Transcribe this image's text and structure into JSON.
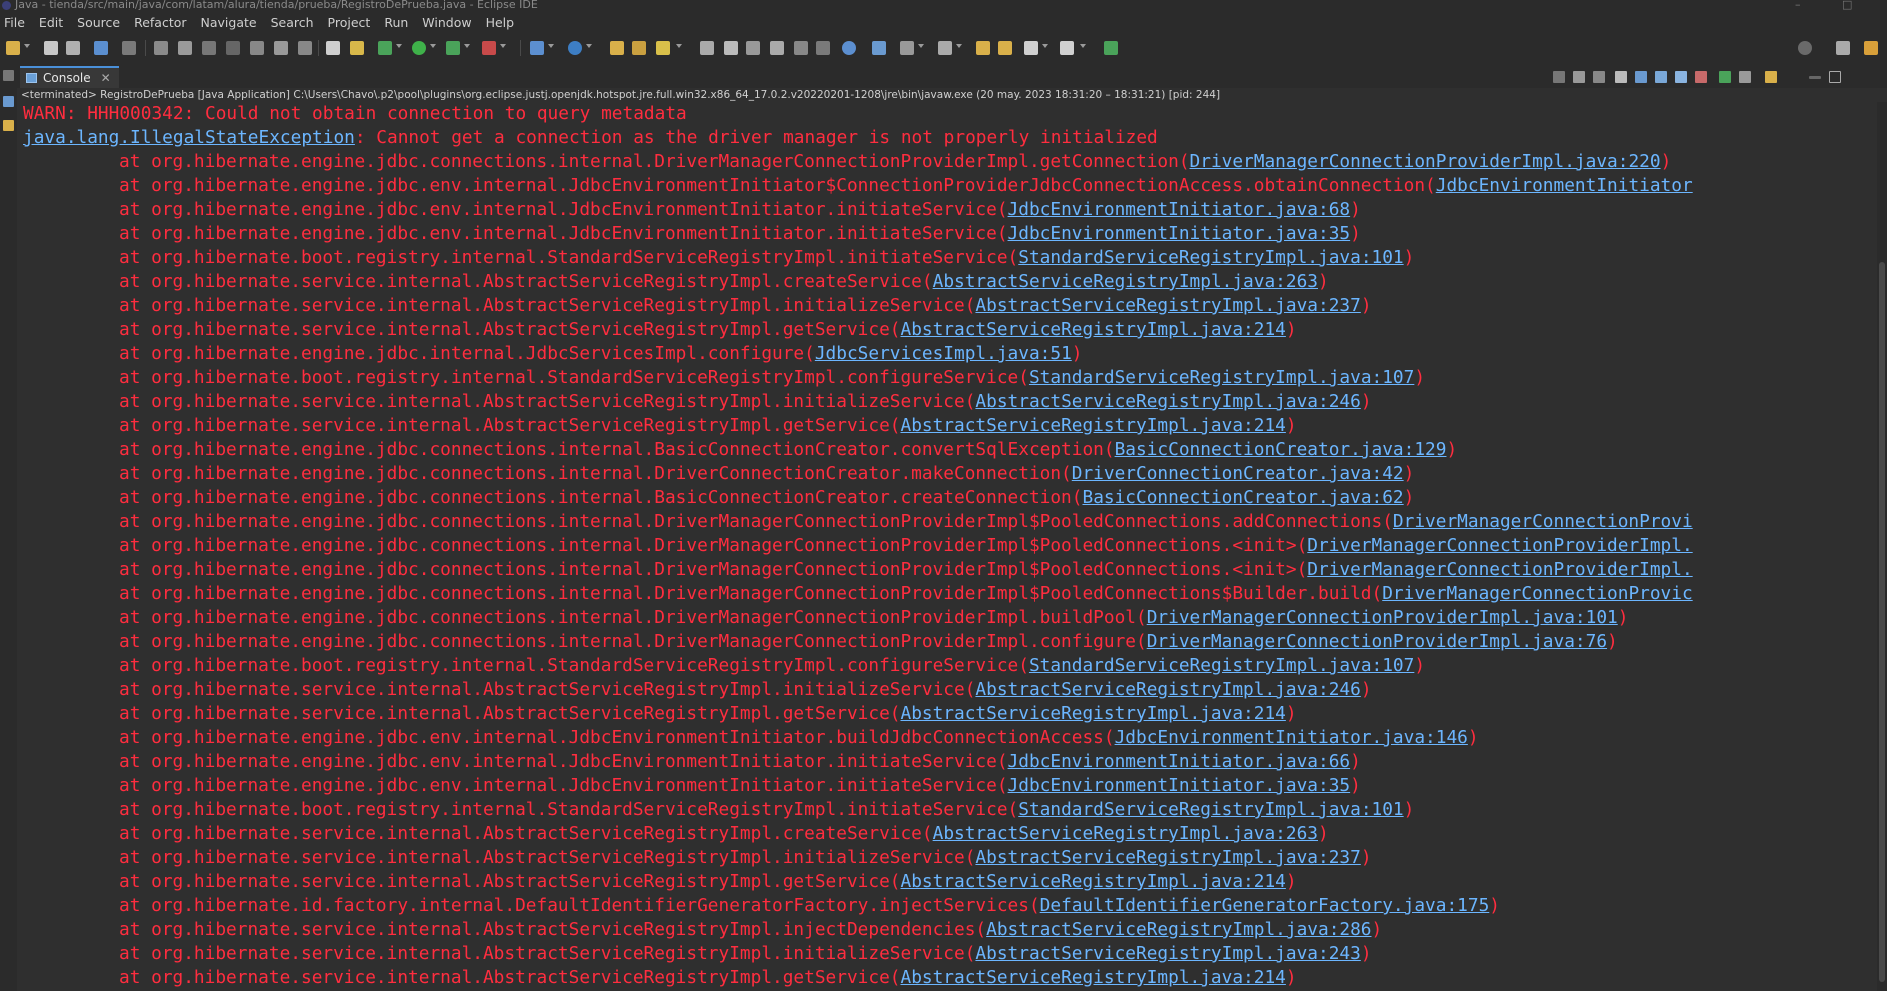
{
  "window": {
    "title": "Java - tienda/src/main/java/com/latam/alura/tienda/prueba/RegistroDePrueba.java - Eclipse IDE"
  },
  "menu": [
    "File",
    "Edit",
    "Source",
    "Refactor",
    "Navigate",
    "Search",
    "Project",
    "Run",
    "Window",
    "Help"
  ],
  "console_tab": {
    "label": "Console"
  },
  "status": "<terminated> RegistroDePrueba [Java Application] C:\\Users\\Chavo\\.p2\\pool\\plugins\\org.eclipse.justj.openjdk.hotspot.jre.full.win32.x86_64_17.0.2.v20220201-1208\\jre\\bin\\javaw.exe  (20 may. 2023 18:31:20 – 18:31:21) [pid: 244]",
  "console": {
    "warn": "WARN: HHH000342: Could not obtain connection to query metadata",
    "exception": {
      "class": "java.lang.IllegalStateException",
      "message": ": Cannot get a connection as the driver manager is not properly initialized"
    },
    "frames": [
      {
        "method": "at org.hibernate.engine.jdbc.connections.internal.DriverManagerConnectionProviderImpl.getConnection(",
        "link": "DriverManagerConnectionProviderImpl.java:220",
        "tail": ")"
      },
      {
        "method": "at org.hibernate.engine.jdbc.env.internal.JdbcEnvironmentInitiator$ConnectionProviderJdbcConnectionAccess.obtainConnection(",
        "link": "JdbcEnvironmentInitiator",
        "tail": ""
      },
      {
        "method": "at org.hibernate.engine.jdbc.env.internal.JdbcEnvironmentInitiator.initiateService(",
        "link": "JdbcEnvironmentInitiator.java:68",
        "tail": ")"
      },
      {
        "method": "at org.hibernate.engine.jdbc.env.internal.JdbcEnvironmentInitiator.initiateService(",
        "link": "JdbcEnvironmentInitiator.java:35",
        "tail": ")"
      },
      {
        "method": "at org.hibernate.boot.registry.internal.StandardServiceRegistryImpl.initiateService(",
        "link": "StandardServiceRegistryImpl.java:101",
        "tail": ")"
      },
      {
        "method": "at org.hibernate.service.internal.AbstractServiceRegistryImpl.createService(",
        "link": "AbstractServiceRegistryImpl.java:263",
        "tail": ")"
      },
      {
        "method": "at org.hibernate.service.internal.AbstractServiceRegistryImpl.initializeService(",
        "link": "AbstractServiceRegistryImpl.java:237",
        "tail": ")"
      },
      {
        "method": "at org.hibernate.service.internal.AbstractServiceRegistryImpl.getService(",
        "link": "AbstractServiceRegistryImpl.java:214",
        "tail": ")"
      },
      {
        "method": "at org.hibernate.engine.jdbc.internal.JdbcServicesImpl.configure(",
        "link": "JdbcServicesImpl.java:51",
        "tail": ")"
      },
      {
        "method": "at org.hibernate.boot.registry.internal.StandardServiceRegistryImpl.configureService(",
        "link": "StandardServiceRegistryImpl.java:107",
        "tail": ")"
      },
      {
        "method": "at org.hibernate.service.internal.AbstractServiceRegistryImpl.initializeService(",
        "link": "AbstractServiceRegistryImpl.java:246",
        "tail": ")"
      },
      {
        "method": "at org.hibernate.service.internal.AbstractServiceRegistryImpl.getService(",
        "link": "AbstractServiceRegistryImpl.java:214",
        "tail": ")"
      },
      {
        "method": "at org.hibernate.engine.jdbc.connections.internal.BasicConnectionCreator.convertSqlException(",
        "link": "BasicConnectionCreator.java:129",
        "tail": ")"
      },
      {
        "method": "at org.hibernate.engine.jdbc.connections.internal.DriverConnectionCreator.makeConnection(",
        "link": "DriverConnectionCreator.java:42",
        "tail": ")"
      },
      {
        "method": "at org.hibernate.engine.jdbc.connections.internal.BasicConnectionCreator.createConnection(",
        "link": "BasicConnectionCreator.java:62",
        "tail": ")"
      },
      {
        "method": "at org.hibernate.engine.jdbc.connections.internal.DriverManagerConnectionProviderImpl$PooledConnections.addConnections(",
        "link": "DriverManagerConnectionProvi",
        "tail": ""
      },
      {
        "method": "at org.hibernate.engine.jdbc.connections.internal.DriverManagerConnectionProviderImpl$PooledConnections.<init>(",
        "link": "DriverManagerConnectionProviderImpl.",
        "tail": ""
      },
      {
        "method": "at org.hibernate.engine.jdbc.connections.internal.DriverManagerConnectionProviderImpl$PooledConnections.<init>(",
        "link": "DriverManagerConnectionProviderImpl.",
        "tail": ""
      },
      {
        "method": "at org.hibernate.engine.jdbc.connections.internal.DriverManagerConnectionProviderImpl$PooledConnections$Builder.build(",
        "link": "DriverManagerConnectionProvic",
        "tail": ""
      },
      {
        "method": "at org.hibernate.engine.jdbc.connections.internal.DriverManagerConnectionProviderImpl.buildPool(",
        "link": "DriverManagerConnectionProviderImpl.java:101",
        "tail": ")"
      },
      {
        "method": "at org.hibernate.engine.jdbc.connections.internal.DriverManagerConnectionProviderImpl.configure(",
        "link": "DriverManagerConnectionProviderImpl.java:76",
        "tail": ")"
      },
      {
        "method": "at org.hibernate.boot.registry.internal.StandardServiceRegistryImpl.configureService(",
        "link": "StandardServiceRegistryImpl.java:107",
        "tail": ")"
      },
      {
        "method": "at org.hibernate.service.internal.AbstractServiceRegistryImpl.initializeService(",
        "link": "AbstractServiceRegistryImpl.java:246",
        "tail": ")"
      },
      {
        "method": "at org.hibernate.service.internal.AbstractServiceRegistryImpl.getService(",
        "link": "AbstractServiceRegistryImpl.java:214",
        "tail": ")"
      },
      {
        "method": "at org.hibernate.engine.jdbc.env.internal.JdbcEnvironmentInitiator.buildJdbcConnectionAccess(",
        "link": "JdbcEnvironmentInitiator.java:146",
        "tail": ")"
      },
      {
        "method": "at org.hibernate.engine.jdbc.env.internal.JdbcEnvironmentInitiator.initiateService(",
        "link": "JdbcEnvironmentInitiator.java:66",
        "tail": ")"
      },
      {
        "method": "at org.hibernate.engine.jdbc.env.internal.JdbcEnvironmentInitiator.initiateService(",
        "link": "JdbcEnvironmentInitiator.java:35",
        "tail": ")"
      },
      {
        "method": "at org.hibernate.boot.registry.internal.StandardServiceRegistryImpl.initiateService(",
        "link": "StandardServiceRegistryImpl.java:101",
        "tail": ")"
      },
      {
        "method": "at org.hibernate.service.internal.AbstractServiceRegistryImpl.createService(",
        "link": "AbstractServiceRegistryImpl.java:263",
        "tail": ")"
      },
      {
        "method": "at org.hibernate.service.internal.AbstractServiceRegistryImpl.initializeService(",
        "link": "AbstractServiceRegistryImpl.java:237",
        "tail": ")"
      },
      {
        "method": "at org.hibernate.service.internal.AbstractServiceRegistryImpl.getService(",
        "link": "AbstractServiceRegistryImpl.java:214",
        "tail": ")"
      },
      {
        "method": "at org.hibernate.id.factory.internal.DefaultIdentifierGeneratorFactory.injectServices(",
        "link": "DefaultIdentifierGeneratorFactory.java:175",
        "tail": ")"
      },
      {
        "method": "at org.hibernate.service.internal.AbstractServiceRegistryImpl.injectDependencies(",
        "link": "AbstractServiceRegistryImpl.java:286",
        "tail": ")"
      },
      {
        "method": "at org.hibernate.service.internal.AbstractServiceRegistryImpl.initializeService(",
        "link": "AbstractServiceRegistryImpl.java:243",
        "tail": ")"
      },
      {
        "method": "at org.hibernate.service.internal.AbstractServiceRegistryImpl.getService(",
        "link": "AbstractServiceRegistryImpl.java:214",
        "tail": ")"
      }
    ]
  },
  "colors": {
    "error_text": "#ff2d3f",
    "link": "#6cb6ff",
    "background": "#2f2f2f",
    "tab_accent": "#4a90d9"
  }
}
